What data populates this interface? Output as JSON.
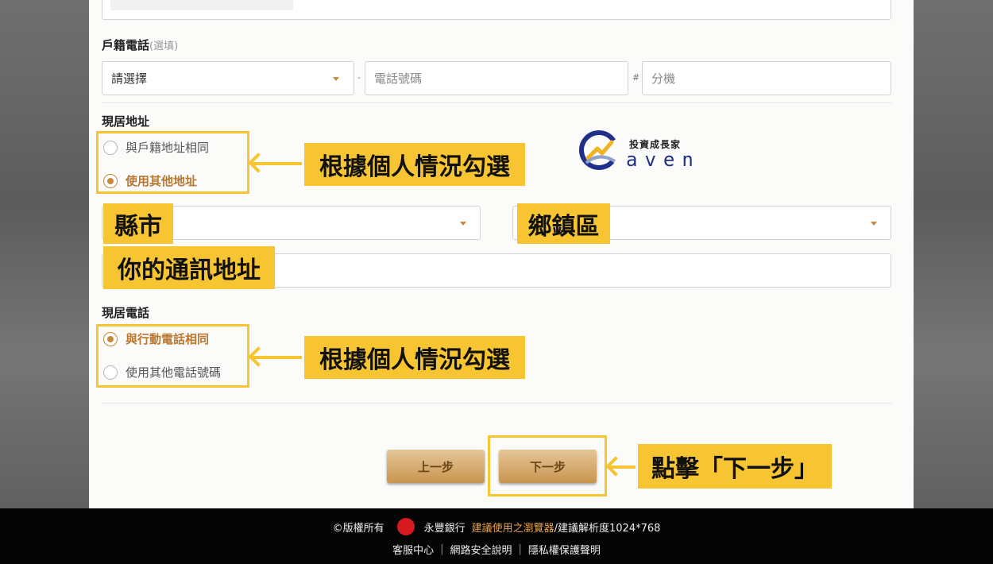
{
  "household_phone": {
    "label": "戶籍電話",
    "optional": "(選填)",
    "area_select": "請選擇",
    "dash": "-",
    "number_placeholder": "電話號碼",
    "hash": "#",
    "ext_placeholder": "分機"
  },
  "current_address": {
    "label": "現居地址",
    "options": [
      "與戶籍地址相同",
      "使用其他地址"
    ],
    "selected": 1
  },
  "current_phone": {
    "label": "現居電話",
    "options": [
      "與行動電話相同",
      "使用其他電話號碼"
    ],
    "selected": 0
  },
  "annotations": {
    "check_by_situation": "根據個人情況勾選",
    "county_city": "縣市",
    "district": "鄉鎮區",
    "your_address": "你的通訊地址",
    "click_next": "點擊「下一步」"
  },
  "watermark": {
    "tagline": "投資成長家",
    "brand": "aven"
  },
  "buttons": {
    "prev": "上一步",
    "next": "下一步"
  },
  "footer": {
    "copyright": "©版權所有",
    "bank": "永豐銀行",
    "browser_link": "建議使用之瀏覽器",
    "resolution": "/建議解析度1024*768",
    "links": [
      "客服中心",
      "網路安全說明",
      "隱私權保護聲明"
    ],
    "divider": "|"
  },
  "colors": {
    "accent": "#c6873e",
    "highlight": "#f7c531",
    "footer_bg": "#050505",
    "footer_link": "#e9a24b"
  }
}
